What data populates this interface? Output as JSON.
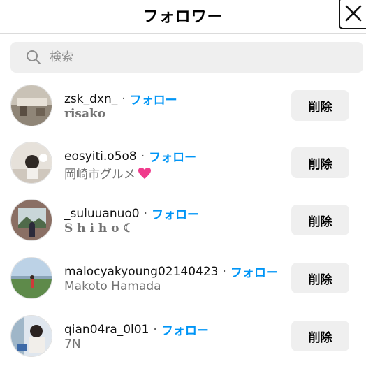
{
  "header": {
    "title": "フォロワー"
  },
  "search": {
    "placeholder": "検索"
  },
  "followers": [
    {
      "username": "zsk_dxn_",
      "follow_label": "フォロー",
      "subtitle": "risako",
      "remove_label": "削除"
    },
    {
      "username": "eosyiti.o5o8",
      "follow_label": "フォロー",
      "subtitle": "岡崎市グルメ",
      "remove_label": "削除"
    },
    {
      "username": "_suluuanuo0",
      "follow_label": "フォロー",
      "subtitle": "S h i h o ☾",
      "remove_label": "削除"
    },
    {
      "username": "malocyakyoung02140423",
      "follow_label": "フォロー",
      "subtitle": "Makoto Hamada",
      "remove_label": "削除"
    },
    {
      "username": "qian04ra_0l01",
      "follow_label": "フォロー",
      "subtitle": "7N",
      "remove_label": "削除"
    }
  ],
  "colors": {
    "follow_blue": "#0095f6",
    "subtitle_gray": "#737373",
    "button_bg": "#efefef"
  },
  "separator": "·"
}
